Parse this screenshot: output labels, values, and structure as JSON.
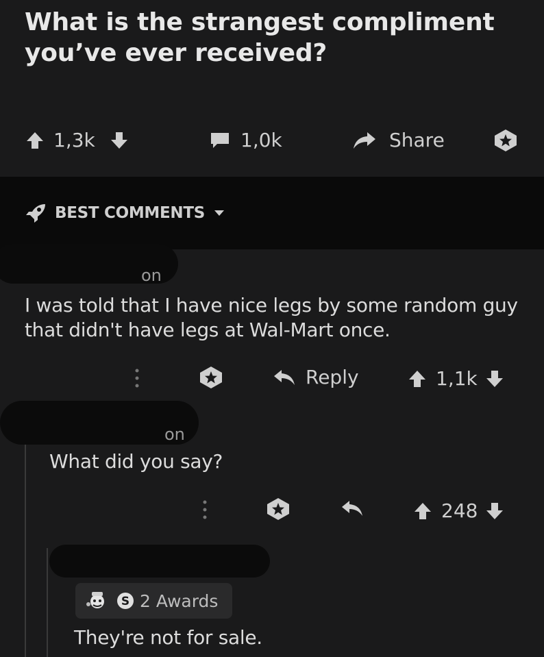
{
  "post": {
    "title": "What is the strangest compliment you’ve ever received?",
    "upvotes": "1,3k",
    "comments": "1,0k",
    "share_label": "Share"
  },
  "sort": {
    "label": "BEST COMMENTS"
  },
  "comments": [
    {
      "username_fragment": "on",
      "body": "I was told that I have nice legs by some random guy that didn't have legs at Wal-Mart once.",
      "reply_label": "Reply",
      "score": "1,1k"
    },
    {
      "username_fragment": "on",
      "body": "What did you say?",
      "score": "248"
    },
    {
      "awards_label": "2 Awards",
      "award_badge_letter": "S",
      "body": "They're not for sale."
    }
  ],
  "colors": {
    "background": "#1a1a1b",
    "band": "#0a0a0a",
    "text": "#dcdcdc",
    "icon": "#cfcfcf"
  }
}
